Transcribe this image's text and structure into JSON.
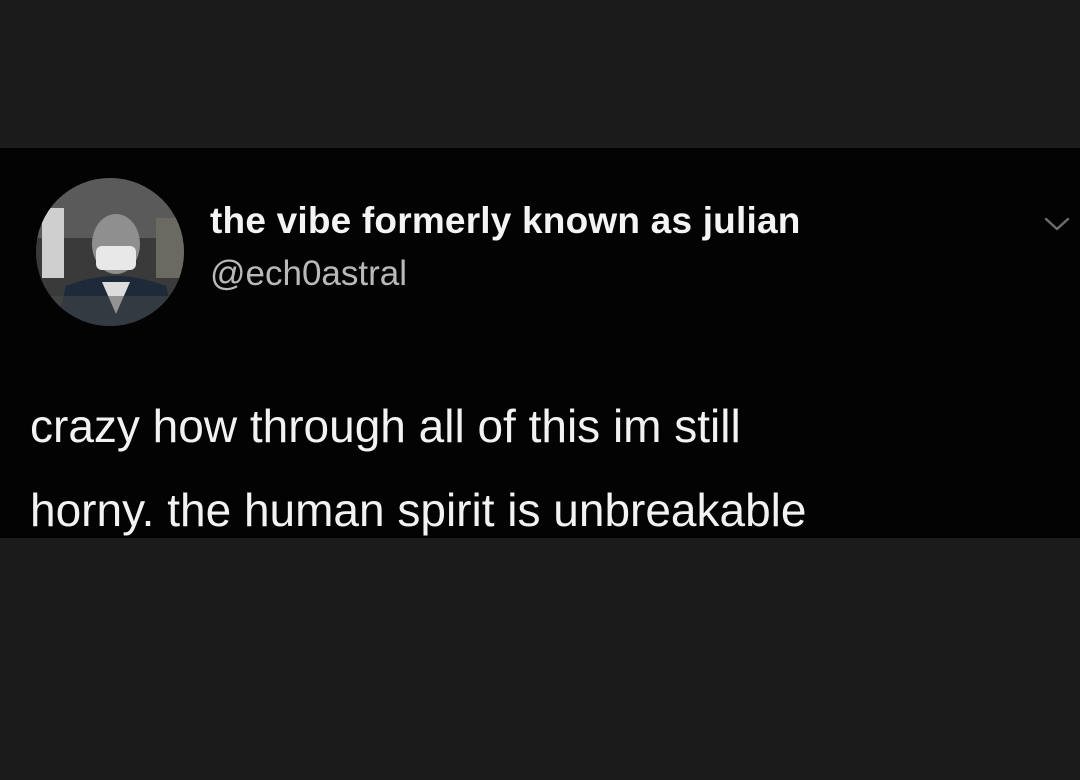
{
  "tweet": {
    "display_name": "the vibe formerly known as julian",
    "handle": "@ech0astral",
    "text_lines": [
      "crazy how through all of this im still",
      "horny. the human spirit is unbreakable"
    ],
    "avatar_icon": "profile-photo",
    "menu_icon": "chevron-down-icon"
  },
  "colors": {
    "page_background": "#1b1b1b",
    "card_background": "#030303",
    "name_text": "#f4f4f4",
    "handle_text": "#b9b9b9",
    "body_text": "#f2f2f2"
  }
}
